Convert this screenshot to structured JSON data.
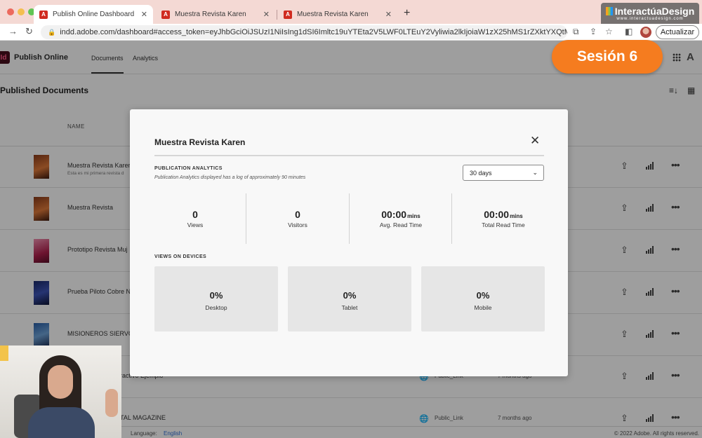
{
  "browser": {
    "tabs": [
      {
        "label": "Publish Online Dashboard",
        "active": true
      },
      {
        "label": "Muestra Revista Karen",
        "active": false
      },
      {
        "label": "Muestra Revista Karen",
        "active": false
      }
    ],
    "url": "indd.adobe.com/dashboard#access_token=eyJhbGciOiJSUzI1NiIsIng1dSI6Imltc19uYTEta2V5LWF0LTEuY2Vyliwia2lkIjoiaW1zX25hMS1rZXktYXQtMSIsI...",
    "update_button": "Actualizar",
    "brand_name": "InteractúaDesign",
    "brand_url": "www.interactuadesign.com"
  },
  "session_badge": "Sesión 6",
  "app": {
    "logo": "Id",
    "name": "Publish Online",
    "tabs": [
      "Documents",
      "Analytics"
    ]
  },
  "section_title": "Published Documents",
  "column_name": "NAME",
  "documents": [
    {
      "name": "Muestra Revista Karen",
      "desc": "Esta es mi primera revista d",
      "link": "",
      "date": ""
    },
    {
      "name": "Muestra Revista",
      "desc": "",
      "link": "",
      "date": ""
    },
    {
      "name": "Prototipo Revista Muj",
      "desc": "",
      "link": "",
      "date": ""
    },
    {
      "name": "Prueba Piloto Cobre N",
      "desc": "",
      "link": "",
      "date": ""
    },
    {
      "name": "MISIONEROS SIERVO",
      "desc": "",
      "link": "",
      "date": ""
    },
    {
      "name": "ractivo Ejemplo",
      "desc": "",
      "link": "Public_Link",
      "date": "7 months ago"
    },
    {
      "name": "TAL MAGAZINE",
      "desc": "",
      "link": "Public_Link",
      "date": "7 months ago"
    }
  ],
  "footer": {
    "language_label": "Language:",
    "language_value": "English",
    "copyright": "© 2022 Adobe. All rights reserved."
  },
  "modal": {
    "title": "Muestra Revista Karen",
    "analytics_title": "PUBLICATION ANALYTICS",
    "analytics_subtitle": "Publication Analytics displayed has a log of approximately 90 minutes",
    "range": "30 days",
    "stats": [
      {
        "value": "0",
        "unit": "",
        "label": "Views"
      },
      {
        "value": "0",
        "unit": "",
        "label": "Visitors"
      },
      {
        "value": "00:00",
        "unit": "mins",
        "label": "Avg. Read Time"
      },
      {
        "value": "00:00",
        "unit": "mins",
        "label": "Total Read Time"
      }
    ],
    "devices_title": "VIEWS ON DEVICES",
    "devices": [
      {
        "value": "0%",
        "label": "Desktop"
      },
      {
        "value": "0%",
        "label": "Tablet"
      },
      {
        "value": "0%",
        "label": "Mobile"
      }
    ]
  },
  "colors": {
    "accent_orange": "#f57c1f",
    "adobe_red": "#d02b20",
    "link_blue": "#2f6fd8"
  }
}
